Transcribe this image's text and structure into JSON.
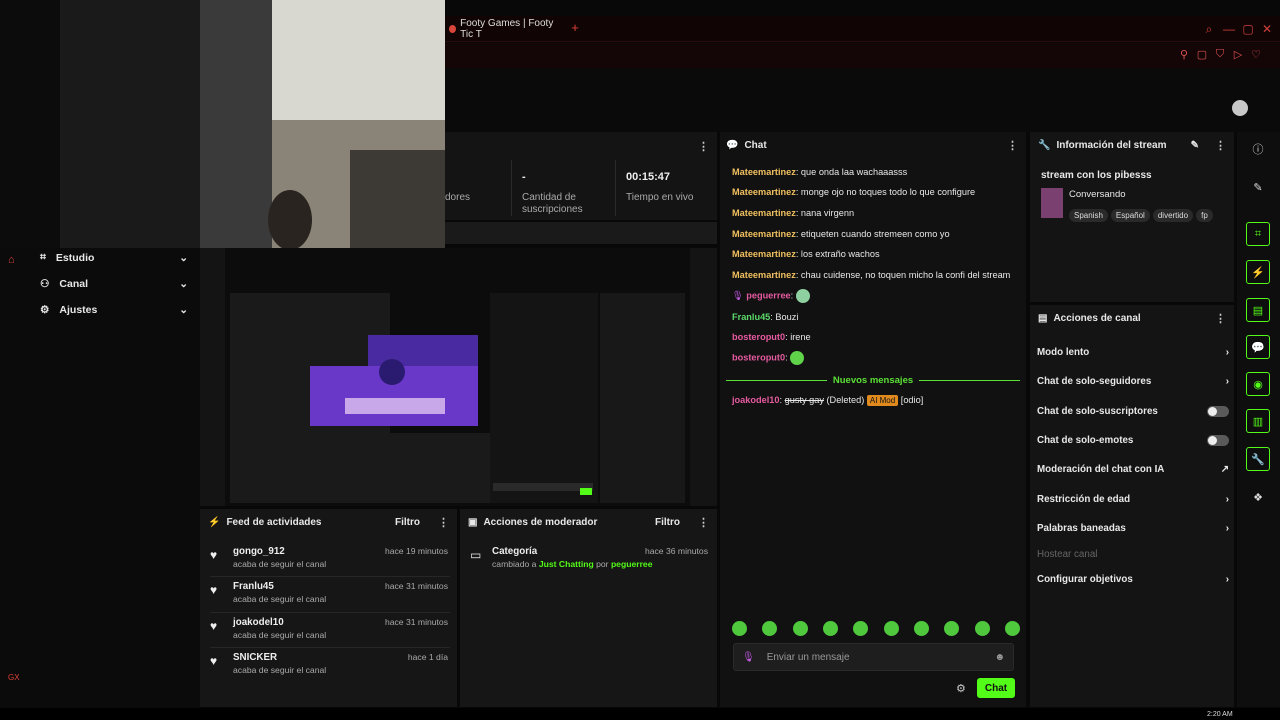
{
  "browser": {
    "tab_title": "Footy Games | Footy Tic T",
    "new_tab": "+",
    "search_icon": "⌕",
    "min": "—",
    "max": "▢",
    "close": "✕"
  },
  "stats": {
    "items": [
      {
        "value": "",
        "label": "dores"
      },
      {
        "value": "-",
        "label": "Cantidad de suscripciones"
      },
      {
        "value": "00:15:47",
        "label": "Tiempo en vivo"
      }
    ]
  },
  "chat": {
    "title": "Chat",
    "messages": [
      {
        "user": "Mateemartinez",
        "text": ": que onda laa wachaaasss"
      },
      {
        "user": "Mateemartinez",
        "text": ": monge ojo no toques todo lo que configure"
      },
      {
        "user": "Mateemartinez",
        "text": ": nana virgenn"
      },
      {
        "user": "Mateemartinez",
        "text": ": etiqueten cuando stremeen como yo"
      },
      {
        "user": "Mateemartinez",
        "text": ": los extraño wachos"
      },
      {
        "user": "Mateemartinez",
        "text": ": chau cuidense, no toquen micho la confi del stream"
      }
    ],
    "m7_user": "peguerree",
    "m7_text": ":",
    "m8_user": "Franlu45",
    "m8_text": ": Bouzi",
    "m9_user": "bosteroput0",
    "m9_text": ": irene",
    "m10_user": "bosteroput0",
    "m10_text": ":",
    "new_messages": "Nuevos mensajes",
    "del_user": "joakodel10",
    "del_word": "gusty gay",
    "del_tag": "(Deleted)",
    "del_mod": "AI Mod",
    "del_reason": "[odio]",
    "input_placeholder": "Enviar un mensaje",
    "send_label": "Chat"
  },
  "info": {
    "title": "Información del stream",
    "stream_title": "stream con los pibesss",
    "category": "Conversando",
    "tags": [
      "Spanish",
      "Español",
      "divertido",
      "fp"
    ]
  },
  "actions": {
    "title": "Acciones de canal",
    "rows": [
      {
        "label": "Modo lento",
        "ctl": "chevron"
      },
      {
        "label": "Chat de solo-seguidores",
        "ctl": "chevron"
      },
      {
        "label": "Chat de solo-suscriptores",
        "ctl": "toggle"
      },
      {
        "label": "Chat de solo-emotes",
        "ctl": "toggle"
      },
      {
        "label": "Moderación del chat con IA",
        "ctl": "ext"
      },
      {
        "label": "Restricción de edad",
        "ctl": "chevron"
      },
      {
        "label": "Palabras baneadas",
        "ctl": "chevron"
      }
    ],
    "host": "Hostear canal",
    "goals": "Configurar objetivos"
  },
  "nav": {
    "items": [
      "Estudio",
      "Canal",
      "Ajustes"
    ]
  },
  "feed": {
    "title": "Feed de actividades",
    "filter": "Filtro",
    "rows": [
      {
        "name": "gongo_912",
        "sub": "acaba de seguir el canal",
        "time": "hace 19 minutos"
      },
      {
        "name": "Franlu45",
        "sub": "acaba de seguir el canal",
        "time": "hace 31 minutos"
      },
      {
        "name": "joakodel10",
        "sub": "acaba de seguir el canal",
        "time": "hace 31 minutos"
      },
      {
        "name": "SNICKER",
        "sub": "acaba de seguir el canal",
        "time": "hace 1 día"
      }
    ]
  },
  "mod": {
    "title": "Acciones de moderador",
    "filter": "Filtro",
    "cat_title": "Categoría",
    "cat_time": "hace 36 minutos",
    "cat_pre": "cambiado a ",
    "cat_game": "Just Chatting",
    "cat_by": " por ",
    "cat_user": "peguerree"
  },
  "left_badge": "GX",
  "clock": "2:20 AM",
  "colors": {
    "accent": "#53fc18",
    "gold": "#f0c060"
  }
}
